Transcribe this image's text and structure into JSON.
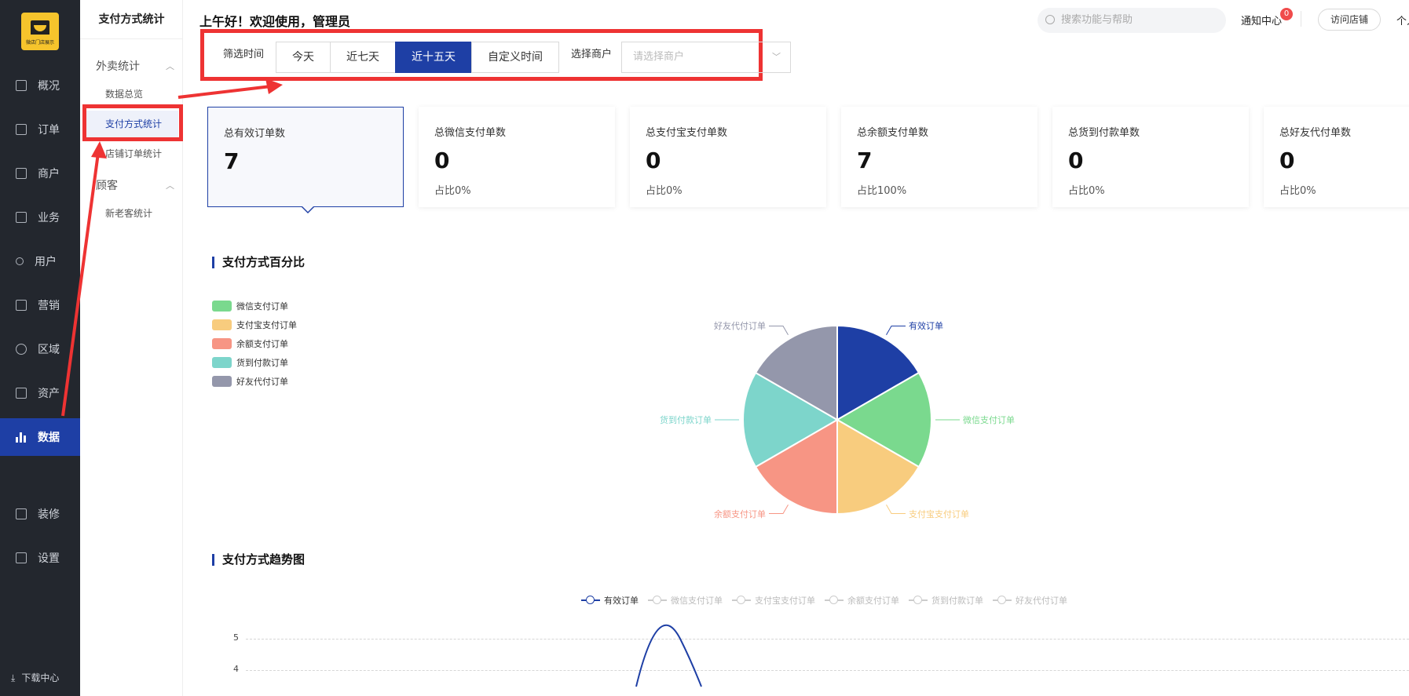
{
  "brand": {
    "logo_text": "微店门店展示"
  },
  "nav1": {
    "items": [
      {
        "label": "概况",
        "icon": "monitor-icon"
      },
      {
        "label": "订单",
        "icon": "order-icon"
      },
      {
        "label": "商户",
        "icon": "store-icon"
      },
      {
        "label": "业务",
        "icon": "business-icon"
      },
      {
        "label": "用户",
        "icon": "user-icon"
      },
      {
        "label": "营销",
        "icon": "marketing-icon"
      },
      {
        "label": "区域",
        "icon": "region-icon"
      },
      {
        "label": "资产",
        "icon": "asset-icon"
      },
      {
        "label": "数据",
        "icon": "bar-chart-icon",
        "active": true
      },
      {
        "label": "装修",
        "icon": "decorate-icon"
      },
      {
        "label": "设置",
        "icon": "settings-icon"
      }
    ],
    "download": "下载中心"
  },
  "nav2": {
    "title": "支付方式统计",
    "group1": "外卖统计",
    "sub1": "数据总览",
    "sub2": "支付方式统计",
    "sub3": "店铺订单统计",
    "group2": "顾客",
    "sub4": "新老客统计"
  },
  "header": {
    "greeting": "上午好！欢迎使用，管理员",
    "search_placeholder": "搜索功能与帮助",
    "notify": "通知中心",
    "notify_count": "0",
    "visit": "访问店铺",
    "person": "个人"
  },
  "filter": {
    "time_label": "筛选时间",
    "options": [
      "今天",
      "近七天",
      "近十五天",
      "自定义时间"
    ],
    "active_index": 2,
    "merchant_label": "选择商户",
    "merchant_placeholder": "请选择商户"
  },
  "cards": [
    {
      "label": "总有效订单数",
      "value": "7",
      "pct": ""
    },
    {
      "label": "总微信支付单数",
      "value": "0",
      "pct": "占比0%"
    },
    {
      "label": "总支付宝支付单数",
      "value": "0",
      "pct": "占比0%"
    },
    {
      "label": "总余额支付单数",
      "value": "7",
      "pct": "占比100%"
    },
    {
      "label": "总货到付款单数",
      "value": "0",
      "pct": "占比0%"
    },
    {
      "label": "总好友代付单数",
      "value": "0",
      "pct": "占比0%"
    }
  ],
  "sections": {
    "pie_title": "支付方式百分比",
    "trend_title": "支付方式趋势图"
  },
  "colors": {
    "primary": "#1e3fa5",
    "wechat": "#7ad98e",
    "alipay": "#f8cc7e",
    "balance": "#f79584",
    "cod": "#7dd5cb",
    "friend": "#9497ab",
    "red_annotation": "#ee3333"
  },
  "chart_data": [
    {
      "type": "pie",
      "title": "支付方式百分比",
      "legend": [
        "微信支付订单",
        "支付宝支付订单",
        "余额支付订单",
        "货到付款订单",
        "好友代付订单"
      ],
      "slices": [
        {
          "name": "有效订单",
          "value": 1,
          "color": "#1e3fa5"
        },
        {
          "name": "微信支付订单",
          "value": 1,
          "color": "#7ad98e"
        },
        {
          "name": "支付宝支付订单",
          "value": 1,
          "color": "#f8cc7e"
        },
        {
          "name": "余额支付订单",
          "value": 1,
          "color": "#f79584"
        },
        {
          "name": "货到付款订单",
          "value": 1,
          "color": "#7dd5cb"
        },
        {
          "name": "好友代付订单",
          "value": 1,
          "color": "#9497ab"
        }
      ]
    },
    {
      "type": "line",
      "title": "支付方式趋势图",
      "legend": [
        "有效订单",
        "微信支付订单",
        "支付宝支付订单",
        "余额支付订单",
        "货到付款订单",
        "好友代付订单"
      ],
      "active_series": "有效订单",
      "y_ticks": [
        5,
        4
      ],
      "series_peak_value": 5
    }
  ]
}
